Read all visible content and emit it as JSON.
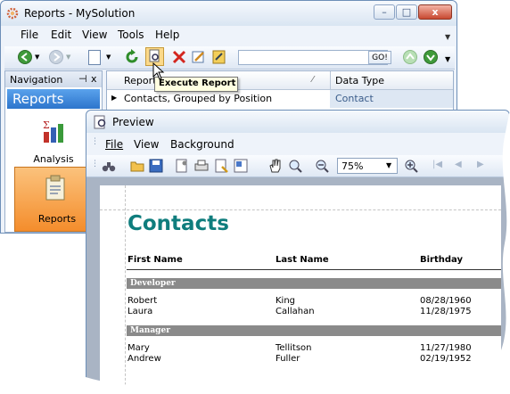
{
  "main_window": {
    "title": "Reports - MySolution",
    "menu": [
      "File",
      "Edit",
      "View",
      "Tools",
      "Help"
    ],
    "go_button": "GO!",
    "tooltip": "Execute Report",
    "nav": {
      "header": "Navigation",
      "pin_glyph": "⊣",
      "close_glyph": "x",
      "group": "Reports",
      "items": [
        {
          "label": "Analysis",
          "icon": "bar-chart-icon"
        },
        {
          "label": "Reports",
          "icon": "clipboard-icon"
        }
      ]
    },
    "grid": {
      "columns": [
        "Report",
        "Data Type"
      ],
      "rows": [
        {
          "report": "Contacts, Grouped by Position",
          "data_type": "Contact"
        }
      ]
    }
  },
  "preview": {
    "title": "Preview",
    "menu": [
      "File",
      "View",
      "Background"
    ],
    "zoom": "75%",
    "report": {
      "title": "Contacts",
      "columns": [
        "First Name",
        "Last Name",
        "Birthday"
      ],
      "groups": [
        {
          "name": "Developer",
          "rows": [
            {
              "first": "Robert",
              "last": "King",
              "birthday": "08/28/1960"
            },
            {
              "first": "Laura",
              "last": "Callahan",
              "birthday": "11/28/1975"
            }
          ]
        },
        {
          "name": "Manager",
          "rows": [
            {
              "first": "Mary",
              "last": "Tellitson",
              "birthday": "11/27/1980"
            },
            {
              "first": "Andrew",
              "last": "Fuller",
              "birthday": "02/19/1952"
            }
          ]
        }
      ]
    }
  },
  "colors": {
    "report_title": "#0f7d7d",
    "nav_group_header": "#3a86d8",
    "selected_nav_item": "#f7a24b",
    "window_border": "#6d8fb8",
    "tooltip_bg": "#ffffe1"
  }
}
